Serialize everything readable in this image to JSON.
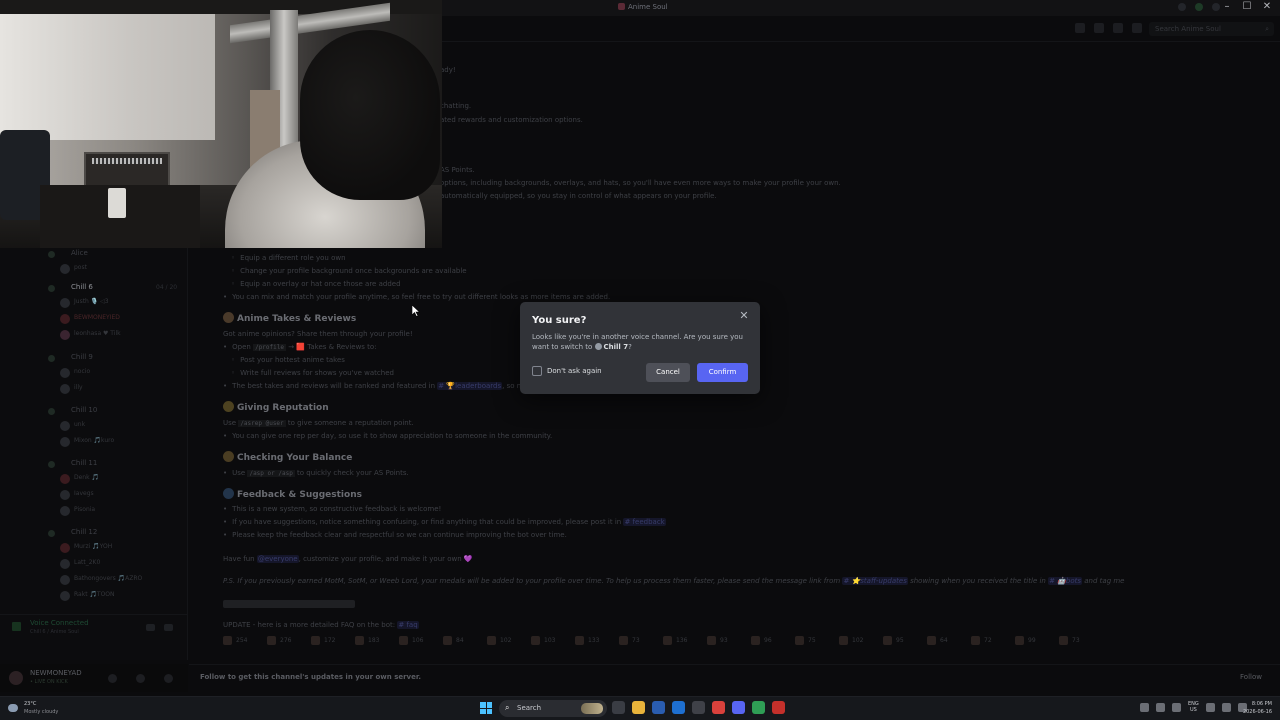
{
  "window": {
    "title": "Anime Soul",
    "search_placeholder": "Search Anime Soul"
  },
  "sidebar": {
    "channels": [
      {
        "name": "Alice",
        "count": ""
      },
      {
        "name": "Chill 6",
        "count": "04 / 20"
      },
      {
        "name": "Chill 9",
        "count": ""
      },
      {
        "name": "Chill 10",
        "count": ""
      },
      {
        "name": "Chill 11",
        "count": ""
      },
      {
        "name": "Chill 12",
        "count": ""
      }
    ],
    "users_top": [
      "post"
    ],
    "users_chill6": [
      "Justh 🎙️ ◁3",
      "BEWMONEYIED",
      "leonhasa ♥ Tilk"
    ],
    "users_chill9": [
      "nocio",
      "illy"
    ],
    "users_chill10": [
      "unk",
      "Mixon 🎵kuro"
    ],
    "users_chill11": [
      "Denk 🎵",
      "Iavegs",
      "Pisonia"
    ],
    "users_chill12": [
      "Murzi 🎵YOH",
      "Latt_2K0",
      "Bathongovers 🎵AZRO",
      "Rakt 🎵TOON"
    ],
    "voice_status": "Voice Connected",
    "voice_channel": "Chill 6 / Anime Soul",
    "user": {
      "name": "NEWMONEYAD",
      "status": "• LIVE ON KICK"
    }
  },
  "chat": {
    "top_lines": [
      "ady!",
      "chatting.",
      "ated rewards and customization options.",
      "AS Points.",
      "options, including backgrounds, overlays, and hats, so you'll have even more ways to make your profile your own.",
      "automatically equipped, so you stay in control of what appears on your profile."
    ],
    "customize_subs": [
      "Equip a different role you own",
      "Change your profile background once backgrounds are available",
      "Equip an overlay or hat once those are added"
    ],
    "mix_match": "You can mix and match your profile anytime, so feel free to try out different looks as more items are added.",
    "takes_heading": "Anime Takes & Reviews",
    "takes_intro": "Got anime opinions? Share them through your profile!",
    "takes_open": "Open",
    "takes_cmd": "/profile",
    "takes_to": "→ 🟥 Takes & Reviews to:",
    "takes_subs": [
      "Post your hottest anime takes",
      "Write full reviews for shows you've watched"
    ],
    "takes_best": "The best takes and reviews will be ranked and featured in",
    "takes_board": "# 🏆leaderboards",
    "takes_tail": ", so mak",
    "rep_heading": "Giving Reputation",
    "rep_use": "Use",
    "rep_cmd": "/asrep @user",
    "rep_tail": "to give someone a reputation point.",
    "rep_line2": "You can give one rep per day, so use it to show appreciation to someone in the community.",
    "bal_heading": "Checking Your Balance",
    "bal_use": "Use",
    "bal_cmd": "/asp or /asp",
    "bal_tail": "to quickly check your AS Points.",
    "fb_heading": "Feedback & Suggestions",
    "fb_1": "This is a new system, so constructive feedback is welcome!",
    "fb_2": "If you have suggestions, notice something confusing, or find anything that could be improved, please post it in",
    "fb_2_link": "# feedback",
    "fb_3": "Please keep the feedback clear and respectful so we can continue improving the bot over time.",
    "have_fun": "Have fun",
    "everyone": "@everyone",
    "have_fun_tail": ", customize your profile, and make it your own 💜",
    "ps_text": "P.S. If you previously earned MotM, SotM, or Weeb Lord, your medals will be added to your profile over time. To help us process them faster, please send the message link from",
    "ps_link1": "# ⭐staff-updates",
    "ps_mid": "showing when you received the title in",
    "ps_link2": "# 🤖bots",
    "ps_end": "and tag me",
    "update_text": "UPDATE - here is a more detailed FAQ on the bot:",
    "update_link": "# faq",
    "reactions": [
      "254",
      "276",
      "172",
      "183",
      "106",
      "84",
      "102",
      "103",
      "133",
      "73",
      "136",
      "93",
      "96",
      "75",
      "102",
      "95",
      "64",
      "72",
      "99",
      "73"
    ],
    "follow_text": "Follow to get this channel's updates in your own server.",
    "follow_btn": "Follow"
  },
  "modal": {
    "title": "You sure?",
    "body_prefix": "Looks like you're in another voice channel. Are you sure you want to switch to",
    "channel": "Chill 7",
    "body_suffix": "?",
    "checkbox_label": "Don't ask again",
    "cancel": "Cancel",
    "confirm": "Confirm",
    "close_glyph": "✕"
  },
  "taskbar": {
    "weather_temp": "23°C",
    "weather_desc": "Mostly cloudy",
    "search": "Search",
    "lang_top": "ENG",
    "lang_bottom": "US",
    "time": "8:06 PM",
    "date": "2026-06-16"
  },
  "colors": {
    "accent": "#5865f2",
    "modal_bg": "#313338",
    "cancel_bg": "#4e5058"
  }
}
